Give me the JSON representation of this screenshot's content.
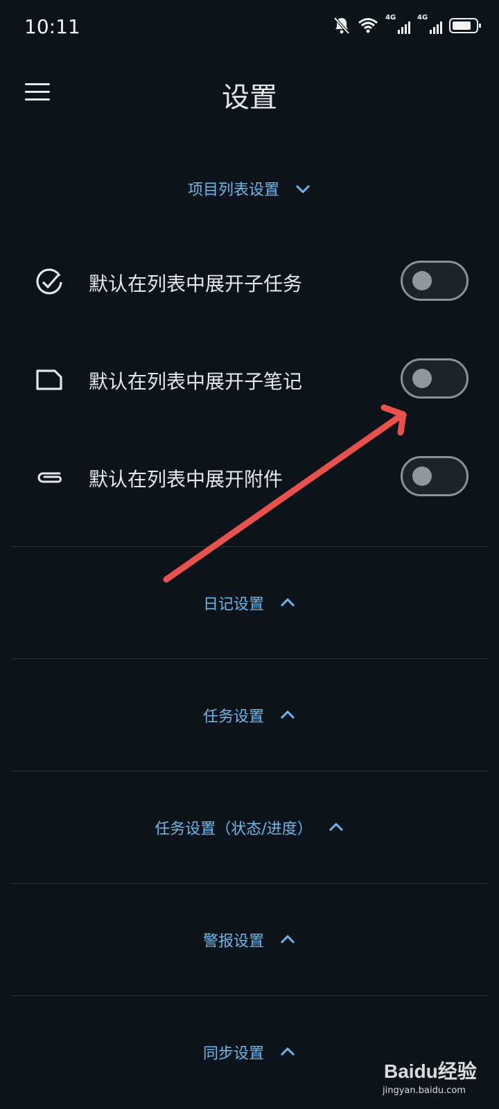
{
  "status_bar": {
    "time": "10:11",
    "signal1_label": "4G",
    "signal2_label": "4G"
  },
  "header": {
    "title": "设置"
  },
  "sections": {
    "project_list": {
      "label": "项目列表设置",
      "expanded": true,
      "items": [
        {
          "label": "默认在列表中展开子任务",
          "icon": "check-circle-icon",
          "enabled": false
        },
        {
          "label": "默认在列表中展开子笔记",
          "icon": "note-icon",
          "enabled": false
        },
        {
          "label": "默认在列表中展开附件",
          "icon": "paperclip-icon",
          "enabled": false
        }
      ]
    },
    "diary": {
      "label": "日记设置",
      "expanded": false
    },
    "task": {
      "label": "任务设置",
      "expanded": false
    },
    "task_status": {
      "label": "任务设置（状态/进度）",
      "expanded": false
    },
    "alarm": {
      "label": "警报设置",
      "expanded": false
    },
    "sync": {
      "label": "同步设置",
      "expanded": false
    }
  },
  "colors": {
    "background": "#0d131a",
    "accent": "#6cb8e8",
    "annotation_arrow": "#e8514c"
  },
  "watermark": {
    "brand": "Baidu经验",
    "url": "jingyan.baidu.com"
  }
}
